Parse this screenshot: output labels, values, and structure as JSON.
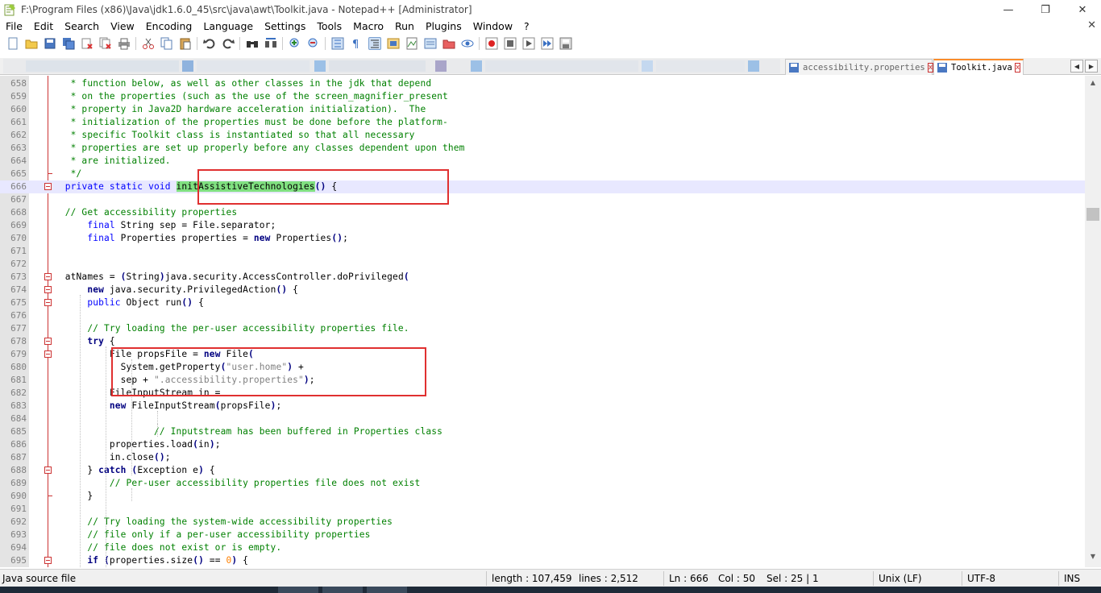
{
  "window": {
    "title": "F:\\Program Files (x86)\\Java\\jdk1.6.0_45\\src\\java\\awt\\Toolkit.java - Notepad++ [Administrator]",
    "controls": {
      "minimize": "—",
      "restore": "❐",
      "close": "✕"
    }
  },
  "menubar": {
    "items": [
      "File",
      "Edit",
      "Search",
      "View",
      "Encoding",
      "Language",
      "Settings",
      "Tools",
      "Macro",
      "Run",
      "Plugins",
      "Window",
      "?"
    ],
    "close": "✕"
  },
  "tabs": [
    {
      "label": "accessibility.properties",
      "active": false
    },
    {
      "label": "Toolkit.java",
      "active": true
    }
  ],
  "tab_close_glyph": "x",
  "tab_arrows": {
    "left": "◀",
    "right": "▶"
  },
  "editor": {
    "first_line": 658,
    "current_line": 666,
    "lines": [
      {
        "n": "658",
        "text": "   * function below, as well as other classes in the jdk that depend"
      },
      {
        "n": "659",
        "text": "   * on the properties (such as the use of the screen_magnifier_present"
      },
      {
        "n": "660",
        "text": "   * property in Java2D hardware acceleration initialization).  The"
      },
      {
        "n": "661",
        "text": "   * initialization of the properties must be done before the platform-"
      },
      {
        "n": "662",
        "text": "   * specific Toolkit class is instantiated so that all necessary"
      },
      {
        "n": "663",
        "text": "   * properties are set up properly before any classes dependent upon them"
      },
      {
        "n": "664",
        "text": "   * are initialized."
      },
      {
        "n": "665",
        "text": "   */"
      },
      {
        "n": "666",
        "text": "  private static void initAssistiveTechnologies() {"
      },
      {
        "n": "667",
        "text": ""
      },
      {
        "n": "668",
        "text": "  // Get accessibility properties"
      },
      {
        "n": "669",
        "text": "      final String sep = File.separator;"
      },
      {
        "n": "670",
        "text": "      final Properties properties = new Properties();"
      },
      {
        "n": "671",
        "text": ""
      },
      {
        "n": "672",
        "text": ""
      },
      {
        "n": "673",
        "text": "  atNames = (String)java.security.AccessController.doPrivileged("
      },
      {
        "n": "674",
        "text": "      new java.security.PrivilegedAction() {"
      },
      {
        "n": "675",
        "text": "      public Object run() {"
      },
      {
        "n": "676",
        "text": ""
      },
      {
        "n": "677",
        "text": "      // Try loading the per-user accessibility properties file."
      },
      {
        "n": "678",
        "text": "      try {"
      },
      {
        "n": "679",
        "text": "          File propsFile = new File("
      },
      {
        "n": "680",
        "text": "            System.getProperty(\"user.home\") +"
      },
      {
        "n": "681",
        "text": "            sep + \".accessibility.properties\");"
      },
      {
        "n": "682",
        "text": "          FileInputStream in ="
      },
      {
        "n": "683",
        "text": "          new FileInputStream(propsFile);"
      },
      {
        "n": "684",
        "text": ""
      },
      {
        "n": "685",
        "text": "                  // Inputstream has been buffered in Properties class"
      },
      {
        "n": "686",
        "text": "          properties.load(in);"
      },
      {
        "n": "687",
        "text": "          in.close();"
      },
      {
        "n": "688",
        "text": "      } catch (Exception e) {"
      },
      {
        "n": "689",
        "text": "          // Per-user accessibility properties file does not exist"
      },
      {
        "n": "690",
        "text": "      }"
      },
      {
        "n": "691",
        "text": ""
      },
      {
        "n": "692",
        "text": "      // Try loading the system-wide accessibility properties"
      },
      {
        "n": "693",
        "text": "      // file only if a per-user accessibility properties"
      },
      {
        "n": "694",
        "text": "      // file does not exist or is empty."
      },
      {
        "n": "695",
        "text": "      if (properties.size() == 0) {"
      }
    ]
  },
  "statusbar": {
    "file_type": "Java source file",
    "length": "length : 107,459",
    "lines": "lines : 2,512",
    "ln": "Ln : 666",
    "col": "Col : 50",
    "sel": "Sel : 25 | 1",
    "eol": "Unix (LF)",
    "encoding": "UTF-8",
    "mode": "INS"
  },
  "scrollbar": {
    "up": "▲",
    "down": "▼"
  },
  "colors": {
    "comment": "#008000",
    "keyword": "#0000ff",
    "keyword_bold": "#000080",
    "string": "#808080",
    "number": "#ff8000",
    "highlight": "#80e080",
    "annotation_box": "#e03030",
    "current_line": "#e8e8ff",
    "fold_margin": "#cc3333"
  },
  "icons": {
    "toolbar": [
      "new-file-icon",
      "open-file-icon",
      "save-icon",
      "save-all-icon",
      "close-icon",
      "close-all-icon",
      "print-icon",
      "cut-icon",
      "copy-icon",
      "paste-icon",
      "undo-icon",
      "redo-icon",
      "find-icon",
      "replace-icon",
      "zoom-in-icon",
      "zoom-out-icon",
      "sync-vertical-icon",
      "sync-horizontal-icon",
      "word-wrap-icon",
      "show-all-chars-icon",
      "indent-guide-icon",
      "udl-icon",
      "doc-map-icon",
      "function-list-icon",
      "folder-workspace-icon",
      "monitor-icon",
      "record-macro-icon",
      "stop-macro-icon",
      "play-macro-icon",
      "run-multiple-macro-icon",
      "save-macro-icon"
    ]
  }
}
